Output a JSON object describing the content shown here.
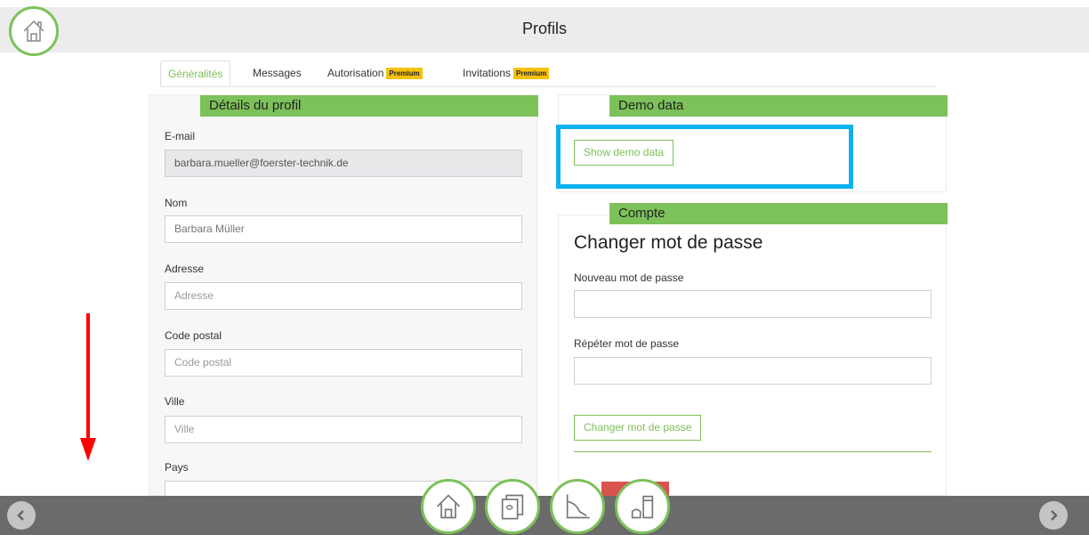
{
  "header": {
    "title": "Profils"
  },
  "tabs": [
    {
      "label": "Généralités",
      "badge": ""
    },
    {
      "label": "Messages",
      "badge": ""
    },
    {
      "label": "Autorisation",
      "badge": "Premium"
    },
    {
      "label": "Invitations",
      "badge": "Premium"
    }
  ],
  "profile": {
    "title": "Détails du profil",
    "email_label": "E-mail",
    "email_value": "barbara.mueller@foerster-technik.de",
    "name_label": "Nom",
    "name_value": "Barbara Müller",
    "address_label": "Adresse",
    "address_placeholder": "Adresse",
    "zip_label": "Code postal",
    "zip_placeholder": "Code postal",
    "city_label": "Ville",
    "city_placeholder": "Ville",
    "country_label": "Pays"
  },
  "demo": {
    "title": "Demo data",
    "button": "Show demo data"
  },
  "account": {
    "title": "Compte",
    "heading": "Changer mot de passe",
    "new_label": "Nouveau mot de passe",
    "repeat_label": "Répéter mot de passe",
    "button": "Changer mot de passe"
  },
  "colors": {
    "accent": "#7dc15a",
    "highlight": "#0bb1ec",
    "premium": "#f5c10e",
    "annotation_arrow": "#ff0000"
  },
  "icons": {
    "home": "home-icon",
    "dock": [
      "home-icon",
      "documents-icon",
      "chart-icon",
      "tools-icon"
    ],
    "prev": "chevron-left-icon",
    "next": "chevron-right-icon"
  }
}
